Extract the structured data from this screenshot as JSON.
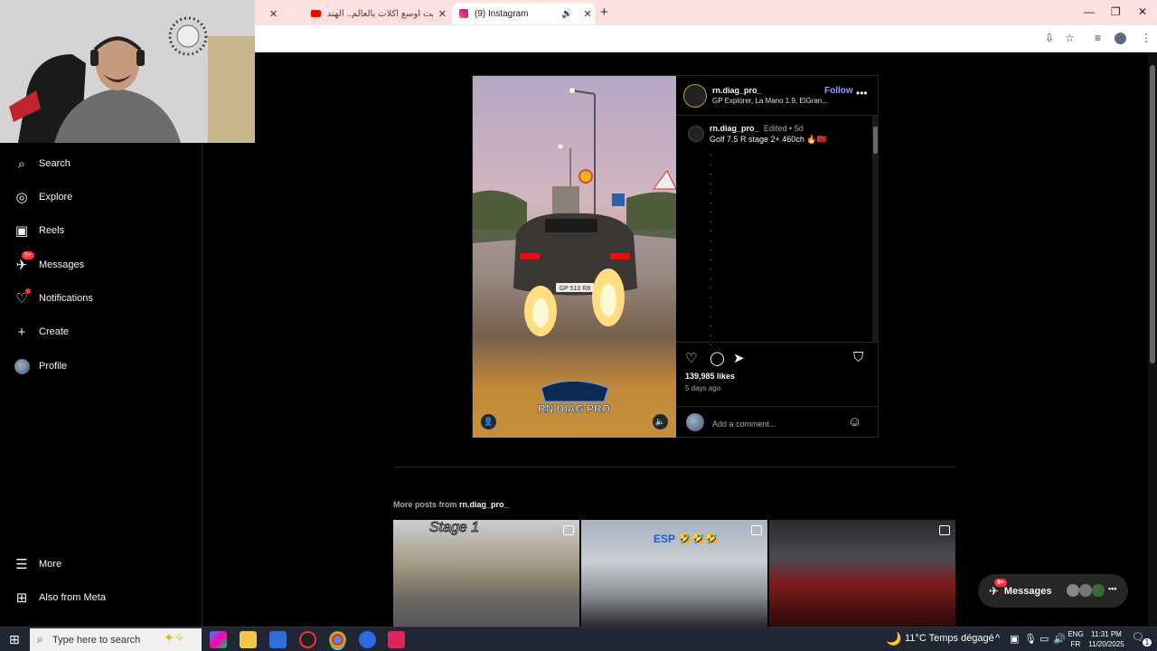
{
  "browser": {
    "tabs": [
      {
        "label": "",
        "close": "✕"
      },
      {
        "label": "جربت أوسع أكلات بالعالم.. الهند 🇮🇳",
        "close": "✕"
      },
      {
        "label": "(9) Instagram",
        "close": "✕"
      }
    ],
    "new_tab": "+"
  },
  "sidebar": {
    "items": [
      {
        "label": "Search",
        "icon": "search-icon"
      },
      {
        "label": "Explore",
        "icon": "compass-icon"
      },
      {
        "label": "Reels",
        "icon": "reels-icon"
      },
      {
        "label": "Messages",
        "icon": "messenger-icon",
        "badge": "9+"
      },
      {
        "label": "Notifications",
        "icon": "heart-icon"
      },
      {
        "label": "Create",
        "icon": "plus-icon"
      },
      {
        "label": "Profile",
        "icon": "avatar"
      },
      {
        "label": "More",
        "icon": "menu-icon"
      },
      {
        "label": "Also from Meta",
        "icon": "meta-icon"
      }
    ]
  },
  "post": {
    "username": "rn.diag_pro_",
    "follow": "Follow",
    "location": "GP Explorer, La Mano 1.9, ElGran...",
    "caption_user": "rn.diag_pro_",
    "caption_meta": "Edited • 5d",
    "caption_text": "Golf 7.5 R  stage 2+  460ch 🔥🇲🇦",
    "likes": "139,985 likes",
    "ago": "5 days ago",
    "comment_placeholder": "Add a comment...",
    "media_logo": "RN DIAG PRO",
    "plate": "GP 510 R8"
  },
  "more_posts": {
    "prefix": "More posts from ",
    "username": "rn.diag_pro_",
    "thumbs": [
      {
        "overlay": "Stage 1"
      },
      {
        "overlay": "ESP 🤣🤣🤣"
      },
      {
        "overlay": ""
      }
    ]
  },
  "messages_pill": {
    "label": "Messages",
    "badge": "9+"
  },
  "taskbar": {
    "search_placeholder": "Type here to search",
    "weather": "11°C  Temps dégagé",
    "lang_top": "ENG",
    "lang_bottom": "FR",
    "time": "11:31 PM",
    "date": "11/20/2025",
    "notif_count": "1"
  },
  "colors": {
    "accent": "#8c9cff",
    "badge": "#ff3040",
    "background": "#000000",
    "tab_bar": "#fbe1df"
  }
}
